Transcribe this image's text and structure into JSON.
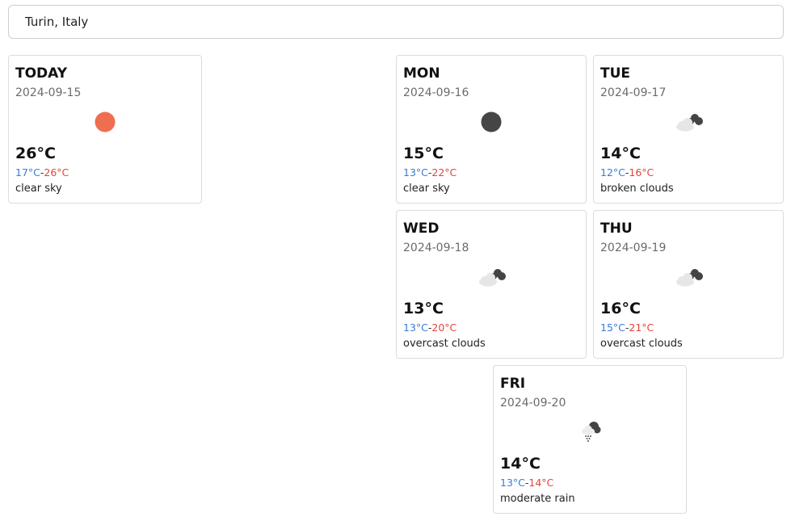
{
  "search": {
    "value": "Turin, Italy"
  },
  "days": [
    {
      "day": "TODAY",
      "date": "2024-09-15",
      "icon": "sun-icon",
      "icon_color": "#ee6e4f",
      "temp": "26°C",
      "low": "17°C",
      "high": "26°C",
      "desc": "clear sky"
    },
    {
      "day": "MON",
      "date": "2024-09-16",
      "icon": "moon-icon",
      "icon_color": "#454545",
      "temp": "15°C",
      "low": "13°C",
      "high": "22°C",
      "desc": "clear sky"
    },
    {
      "day": "TUE",
      "date": "2024-09-17",
      "icon": "broken-clouds-icon",
      "temp": "14°C",
      "low": "12°C",
      "high": "16°C",
      "desc": "broken clouds"
    },
    {
      "day": "WED",
      "date": "2024-09-18",
      "icon": "overcast-clouds-icon",
      "temp": "13°C",
      "low": "13°C",
      "high": "20°C",
      "desc": "overcast clouds"
    },
    {
      "day": "THU",
      "date": "2024-09-19",
      "icon": "overcast-clouds-icon",
      "temp": "16°C",
      "low": "15°C",
      "high": "21°C",
      "desc": "overcast clouds"
    },
    {
      "day": "FRI",
      "date": "2024-09-20",
      "icon": "rain-icon",
      "temp": "14°C",
      "low": "13°C",
      "high": "14°C",
      "desc": "moderate rain"
    }
  ],
  "colors": {
    "low_temp": "#3a7bd5",
    "high_temp": "#e0443b"
  },
  "range_separator": "-"
}
